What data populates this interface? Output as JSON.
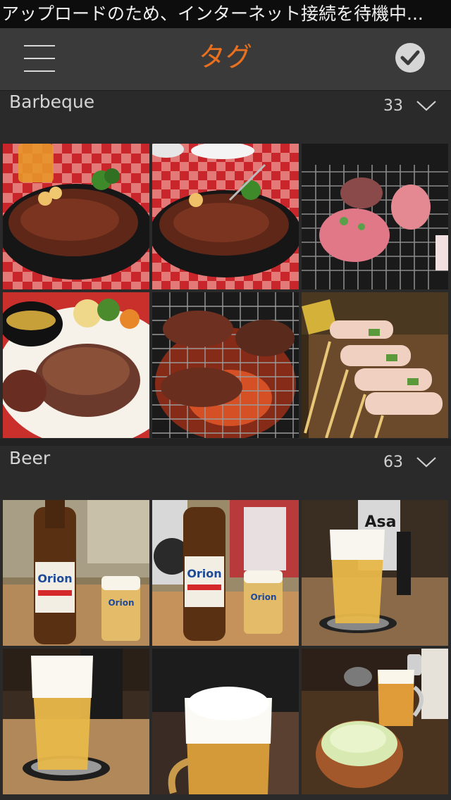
{
  "status_bar": {
    "message": "アップロードのため、インターネット接続を待機中..."
  },
  "nav": {
    "title": "タグ",
    "menu_icon": "hamburger-menu-icon",
    "done_icon": "checkmark-circle-icon"
  },
  "sections": [
    {
      "name": "Barbeque",
      "count": "33",
      "chevron_icon": "chevron-down-icon",
      "photos": [
        "steak-plate-red-checkered-tablecloth",
        "steak-plate-with-fork",
        "meat-on-grill",
        "steak-with-sauce-cup",
        "beef-on-charcoal-grill",
        "bacon-wrapped-skewers"
      ]
    },
    {
      "name": "Beer",
      "count": "63",
      "chevron_icon": "chevron-down-icon",
      "photos": [
        "orion-beer-bottle-and-glass",
        "orion-beer-bottle-with-photographer",
        "beer-glass-with-asahi-can",
        "beer-glass-on-coaster",
        "beer-mug-with-foam",
        "beer-mug-and-cabbage-salad"
      ]
    }
  ],
  "colors": {
    "accent": "#e8701e",
    "background": "#2a2a2a",
    "nav_background": "#3a3a3a",
    "status_background": "#0d0d0d"
  }
}
